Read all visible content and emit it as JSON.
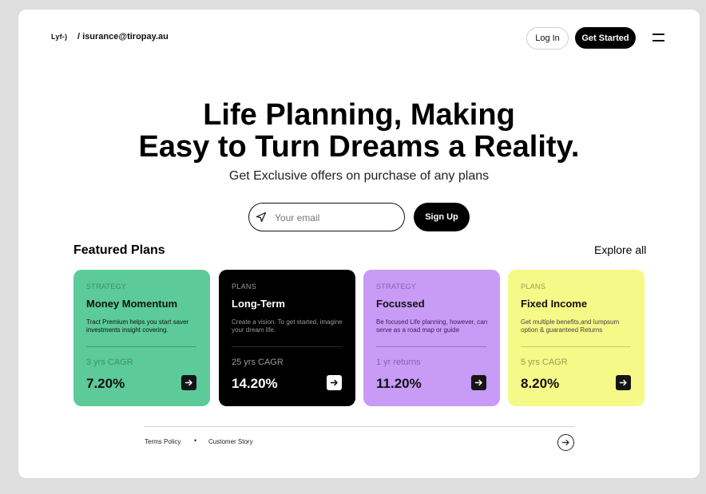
{
  "header": {
    "logo": "Lyf-)",
    "breadcrumb": "/ isurance@tiropay.au",
    "login_label": "Log In",
    "get_started_label": "Get Started"
  },
  "hero": {
    "title_line1": "Life Planning, Making",
    "title_line2": "Easy to Turn Dreams a Reality.",
    "subtitle": "Get Exclusive offers on purchase of any plans",
    "email_placeholder": "Your email",
    "email_value": "",
    "signup_label": "Sign Up"
  },
  "featured": {
    "title": "Featured Plans",
    "explore_label": "Explore all",
    "cards": [
      {
        "category": "STRATEGY",
        "name": "Money Momentum",
        "description": "Tract Premium helps you start saver investments insight covering.",
        "metric": "3 yrs CAGR",
        "value": "7.20%",
        "color": "#5ccb99"
      },
      {
        "category": "PLANS",
        "name": "Long-Term",
        "description": "Create a vision. To get started, imagine your dream life.",
        "metric": "25 yrs CAGR",
        "value": "14.20%",
        "color": "#000000"
      },
      {
        "category": "STRATEGY",
        "name": "Focussed",
        "description": "Be focused Life planning, however, can serve as a road map or guide",
        "metric": "1 yr returns",
        "value": "11.20%",
        "color": "#c79bf6"
      },
      {
        "category": "PLANS",
        "name": "Fixed Income",
        "description": "Get multiple benefits,and lumpsum option & guaranteed Returns",
        "metric": "5 yrs CAGR",
        "value": "8.20%",
        "color": "#f5f987"
      }
    ]
  },
  "footer": {
    "terms_label": "Terms Policy",
    "separator": "•",
    "story_label": "Customer Story"
  },
  "icons": {
    "menu": "hamburger-menu-icon",
    "send": "send-icon",
    "arrow": "arrow-right-icon"
  }
}
